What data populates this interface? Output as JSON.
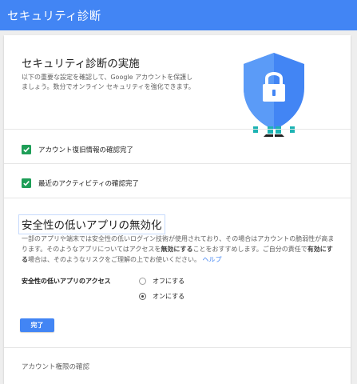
{
  "app_bar": {
    "title": "セキュリティ診断"
  },
  "hero": {
    "title": "セキュリティ診断の実施",
    "description": "以下の重要な設定を確認して、Google アカウントを保護しましょう。数分でオンライン セキュリティを強化できます。",
    "illustration_icon": "shield-lock-person-icon"
  },
  "checks": [
    {
      "label": "アカウント復旧情報の確認完了",
      "checked": true
    },
    {
      "label": "最近のアクティビティの確認完了",
      "checked": true
    }
  ],
  "less_secure_apps": {
    "title": "安全性の低いアプリの無効化",
    "description": {
      "part1": "一部のアプリや端末では安全性の低いログイン技術が使用されており、その場合はアカウントの脆弱性が高まります。そのようなアプリについてはアクセスを",
      "bold1": "無効にする",
      "part2": "ことをおすすめします。ご自分の責任で",
      "bold2": "有効にする",
      "part3": "場合は、そのようなリスクをご理解の上でお使いください。",
      "help_link": "ヘルプ"
    },
    "access_label": "安全性の低いアプリのアクセス",
    "options": [
      {
        "label": "オフにする",
        "selected": false
      },
      {
        "label": "オンにする",
        "selected": true
      }
    ],
    "done_button": "完了"
  },
  "footer": {
    "next_step": "アカウント権限の確認"
  },
  "colors": {
    "app_bar": "#4285f4",
    "check": "#1e9e57",
    "link": "#4285f4",
    "button": "#4285f4"
  }
}
